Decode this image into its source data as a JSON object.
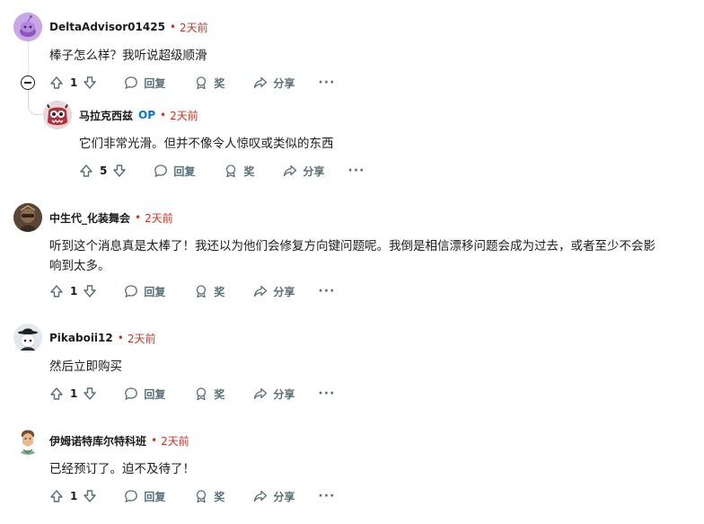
{
  "comments": [
    {
      "author": "DeltaAdvisor01425",
      "time": "2天前",
      "text": "棒子怎么样？我听说超级顺滑",
      "votes": "1",
      "reply": "回复",
      "award": "奖",
      "share": "分享",
      "more": "···"
    },
    {
      "author": "马拉克西兹",
      "op_badge": "OP",
      "time": "2天前",
      "text": "它们非常光滑。但并不像令人惊叹或类似的东西",
      "votes": "5",
      "reply": "回复",
      "award": "奖",
      "share": "分享",
      "more": "···"
    },
    {
      "author": "中生代_化装舞会",
      "time": "2天前",
      "text": "听到这个消息真是太棒了！我还以为他们会修复方向键问题呢。我倒是相信漂移问题会成为过去，或者至少不会影响到太多。",
      "votes": "1",
      "reply": "回复",
      "award": "奖",
      "share": "分享",
      "more": "···"
    },
    {
      "author": "Pikaboii12",
      "time": "2天前",
      "text": "然后立即购买",
      "votes": "1",
      "reply": "回复",
      "award": "奖",
      "share": "分享",
      "more": "···"
    },
    {
      "author": "伊姆诺特库尔特科班",
      "time": "2天前",
      "text": "已经预订了。迫不及待了！",
      "votes": "1",
      "reply": "回复",
      "award": "奖",
      "share": "分享",
      "more": "···"
    }
  ],
  "separator": "•",
  "colors": {
    "time_red": "#c0392b",
    "op_blue": "#0079d3",
    "action_gray": "#576f76",
    "avatar1": "#c9a6e8"
  },
  "icons": [
    "upvote-icon",
    "downvote-icon",
    "comment-bubble-icon",
    "award-icon",
    "share-arrow-icon",
    "collapse-icon"
  ]
}
